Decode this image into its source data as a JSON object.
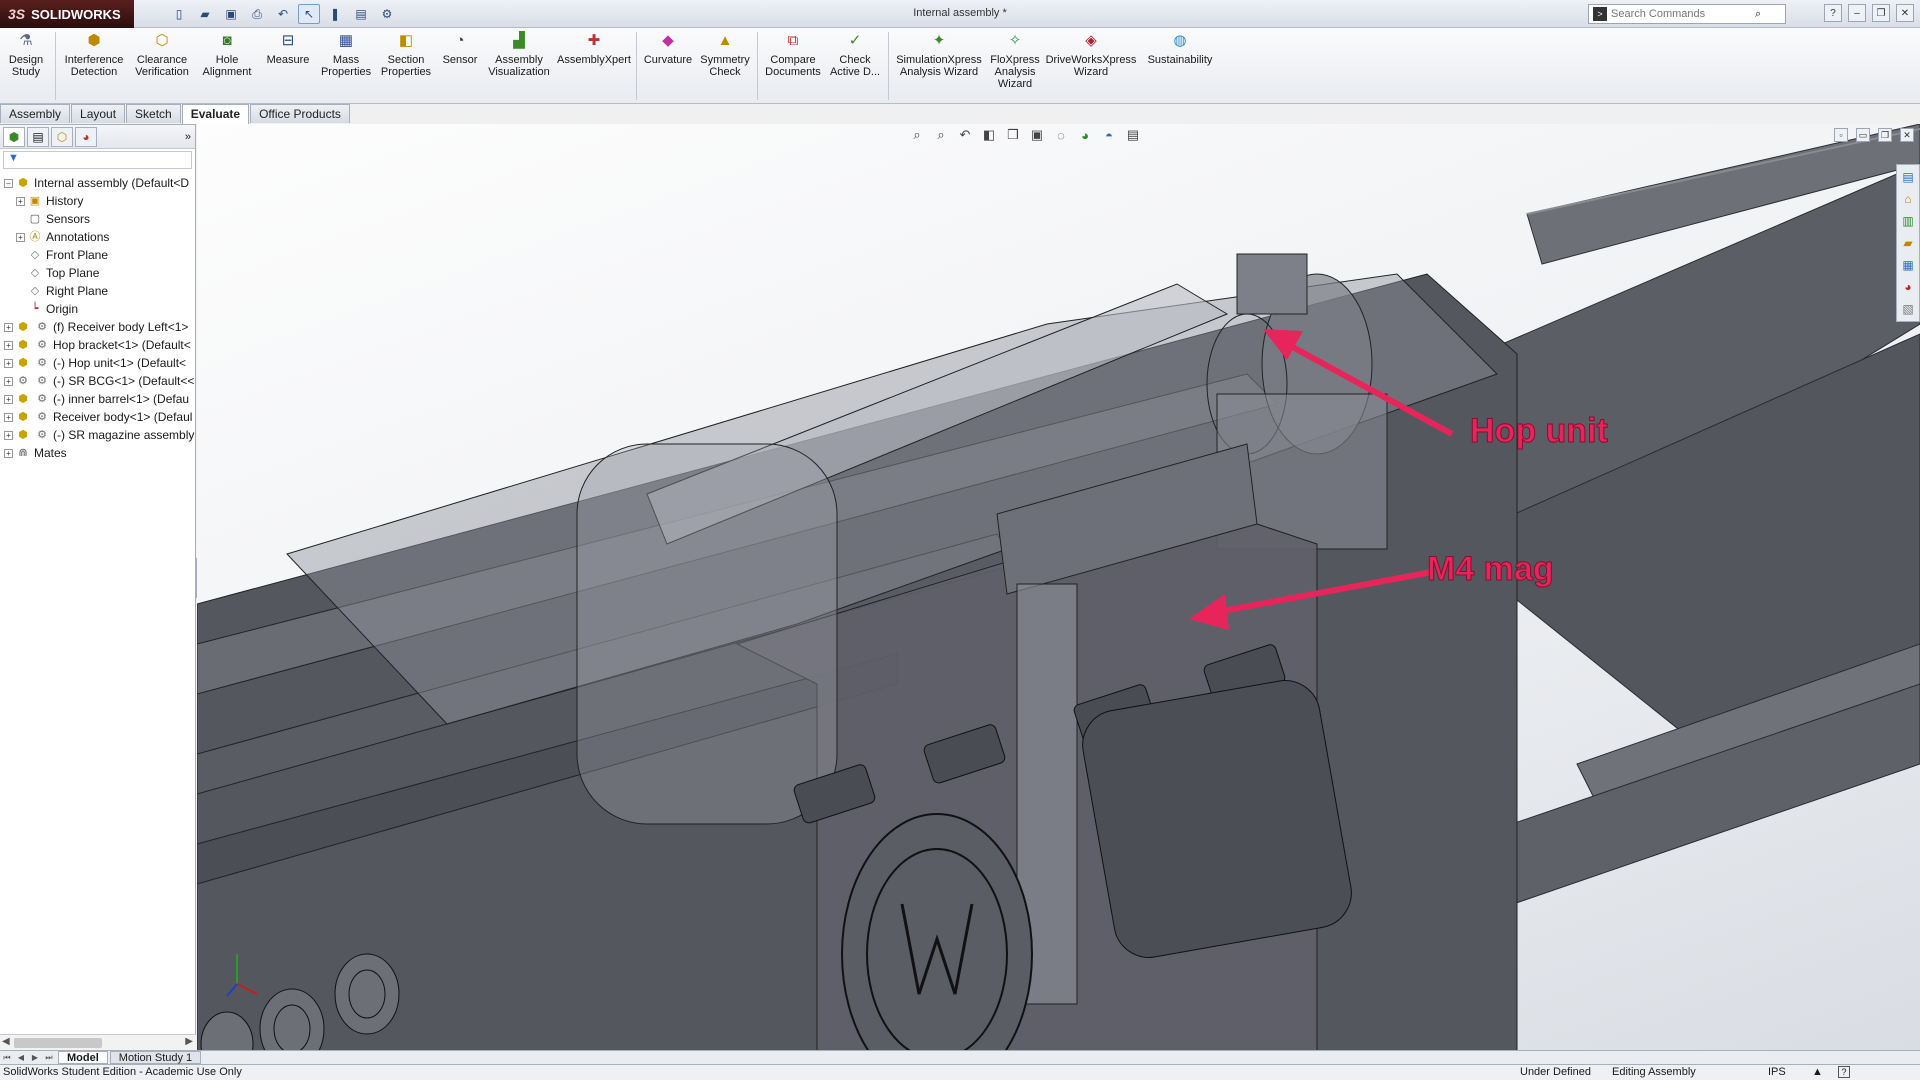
{
  "titlebar": {
    "app_name": "SOLIDWORKS",
    "doc_title": "Internal assembly *",
    "search_placeholder": "Search Commands",
    "quick_access": [
      "new-icon",
      "open-icon",
      "save-icon",
      "print-icon",
      "undo-icon",
      "select-icon",
      "rebuild-icon",
      "file-properties-icon",
      "options-icon"
    ]
  },
  "command_manager": {
    "buttons": [
      {
        "label": "Design Study",
        "icon": "design-study-icon"
      },
      {
        "label": "Interference Detection",
        "icon": "interference-icon"
      },
      {
        "label": "Clearance Verification",
        "icon": "clearance-icon"
      },
      {
        "label": "Hole Alignment",
        "icon": "hole-alignment-icon"
      },
      {
        "label": "Measure",
        "icon": "measure-icon"
      },
      {
        "label": "Mass Properties",
        "icon": "mass-properties-icon"
      },
      {
        "label": "Section Properties",
        "icon": "section-properties-icon"
      },
      {
        "label": "Sensor",
        "icon": "sensor-icon"
      },
      {
        "label": "Assembly Visualization",
        "icon": "assembly-visualization-icon"
      },
      {
        "label": "AssemblyXpert",
        "icon": "assemblyxpert-icon"
      },
      {
        "label": "Curvature",
        "icon": "curvature-icon"
      },
      {
        "label": "Symmetry Check",
        "icon": "symmetry-icon"
      },
      {
        "label": "Compare Documents",
        "icon": "compare-icon"
      },
      {
        "label": "Check Active D...",
        "icon": "check-icon"
      },
      {
        "label": "SimulationXpress Analysis Wizard",
        "icon": "simulation-icon"
      },
      {
        "label": "FloXpress Analysis Wizard",
        "icon": "floxpress-icon"
      },
      {
        "label": "DriveWorksXpress Wizard",
        "icon": "driveworks-icon"
      },
      {
        "label": "Sustainability",
        "icon": "sustainability-icon"
      }
    ]
  },
  "tabs": [
    "Assembly",
    "Layout",
    "Sketch",
    "Evaluate",
    "Office Products"
  ],
  "active_tab": "Evaluate",
  "feature_tree": {
    "items": [
      {
        "label": "Internal assembly  (Default<D",
        "icon": "assembly-icon"
      },
      {
        "label": "History",
        "icon": "history-icon"
      },
      {
        "label": "Sensors",
        "icon": "sensors-icon"
      },
      {
        "label": "Annotations",
        "icon": "annotations-icon"
      },
      {
        "label": "Front Plane",
        "icon": "plane-icon"
      },
      {
        "label": "Top Plane",
        "icon": "plane-icon"
      },
      {
        "label": "Right Plane",
        "icon": "plane-icon"
      },
      {
        "label": "Origin",
        "icon": "origin-icon"
      },
      {
        "label": "(f) Receiver body Left<1>",
        "icon": "assembly-icon"
      },
      {
        "label": "Hop bracket<1> (Default<",
        "icon": "assembly-icon"
      },
      {
        "label": "(-) Hop unit<1> (Default<",
        "icon": "assembly-icon"
      },
      {
        "label": "(-) SR BCG<1> (Default<<",
        "icon": "part-icon"
      },
      {
        "label": "(-) inner barrel<1> (Defau",
        "icon": "assembly-icon"
      },
      {
        "label": "Receiver body<1> (Defaul",
        "icon": "assembly-icon"
      },
      {
        "label": "(-) SR magazine assembly",
        "icon": "assembly-icon"
      },
      {
        "label": "Mates",
        "icon": "mates-icon"
      }
    ]
  },
  "viewport": {
    "annotations": [
      {
        "text": "Hop unit"
      },
      {
        "text": "M4 mag"
      }
    ],
    "accent_color": "#e8255a"
  },
  "bottom_tabs": [
    "Model",
    "Motion Study 1"
  ],
  "status_bar": {
    "left": "SolidWorks Student Edition - Academic Use Only",
    "state": "Under Defined",
    "mode": "Editing Assembly",
    "units": "IPS"
  }
}
